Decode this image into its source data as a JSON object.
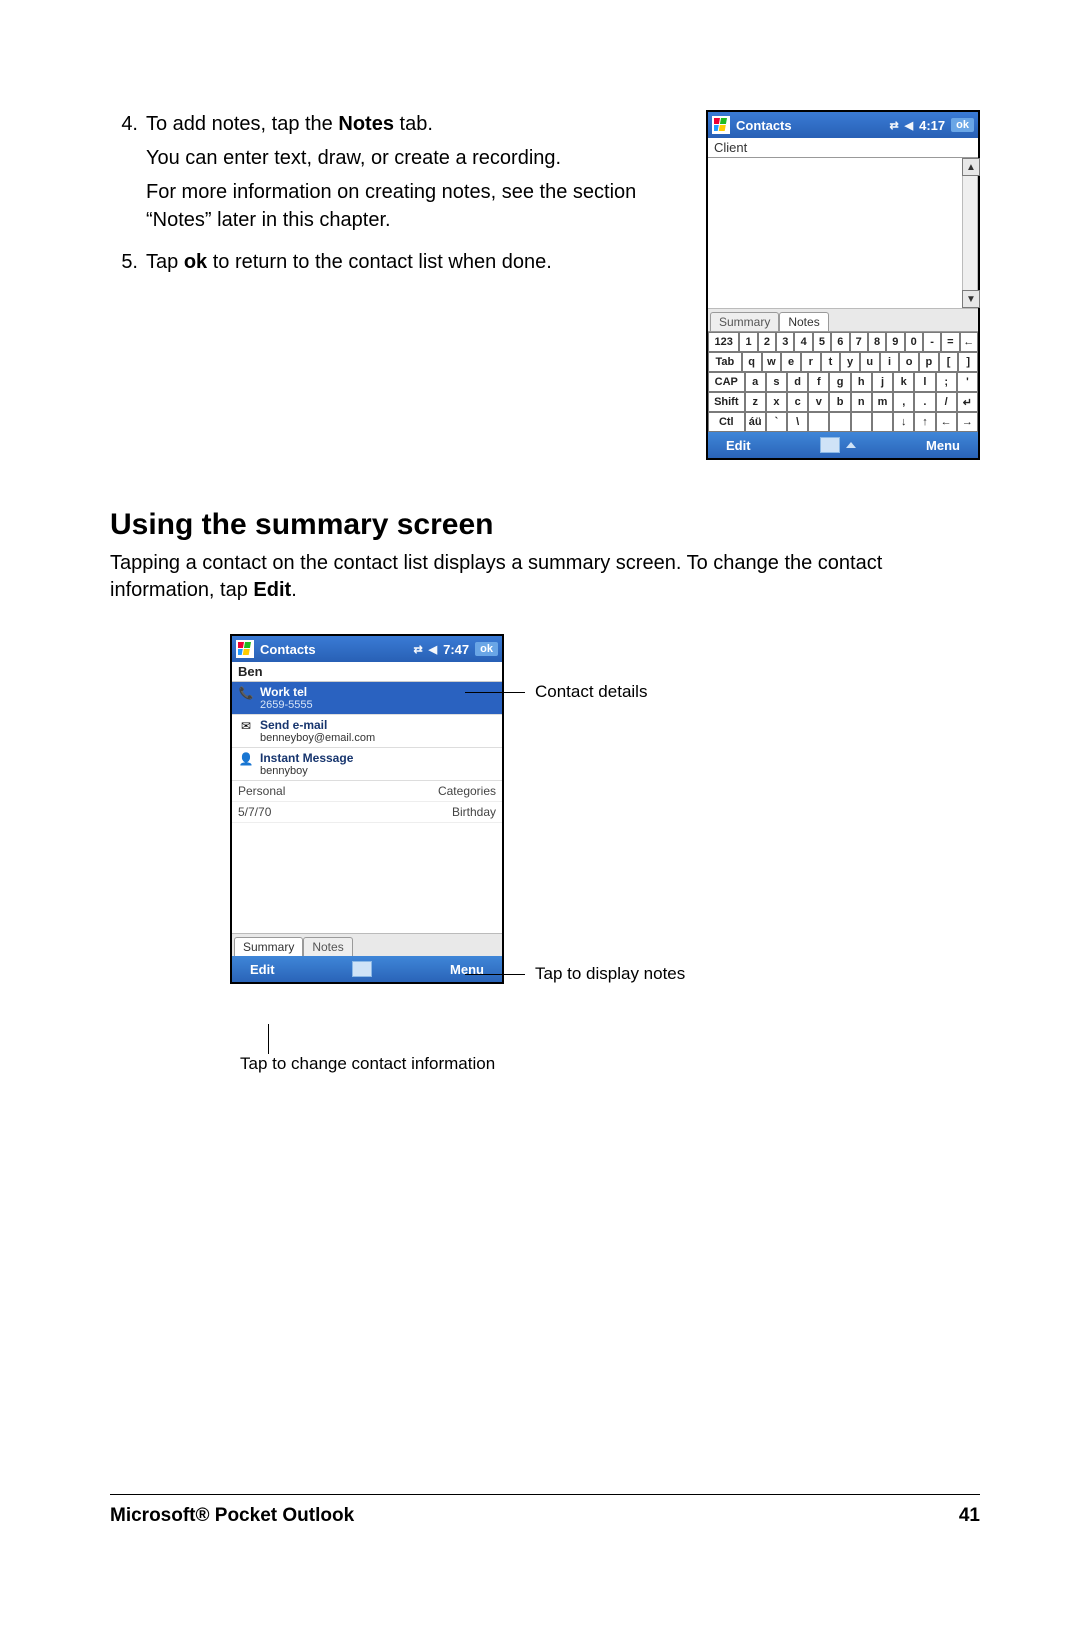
{
  "steps": {
    "item4": {
      "num": "4.",
      "line1_a": "To add notes, tap the ",
      "line1_b": "Notes",
      "line1_c": " tab.",
      "line2": "You can enter text, draw, or create a recording.",
      "line3": "For more information on creating notes, see the section  “Notes” later in this chapter."
    },
    "item5": {
      "num": "5.",
      "line1_a": "Tap ",
      "line1_b": "ok",
      "line1_c": " to return to the contact list when done."
    }
  },
  "device1": {
    "title": "Contacts",
    "time": "4:17",
    "ok": "ok",
    "note_text": "Client",
    "tab_summary": "Summary",
    "tab_notes": "Notes",
    "soft_left": "Edit",
    "soft_right": "Menu",
    "kb": {
      "r1": [
        "123",
        "1",
        "2",
        "3",
        "4",
        "5",
        "6",
        "7",
        "8",
        "9",
        "0",
        "-",
        "=",
        "←"
      ],
      "r2": [
        "Tab",
        "q",
        "w",
        "e",
        "r",
        "t",
        "y",
        "u",
        "i",
        "o",
        "p",
        "[",
        "]"
      ],
      "r3": [
        "CAP",
        "a",
        "s",
        "d",
        "f",
        "g",
        "h",
        "j",
        "k",
        "l",
        ";",
        "'"
      ],
      "r4": [
        "Shift",
        "z",
        "x",
        "c",
        "v",
        "b",
        "n",
        "m",
        ",",
        ".",
        "/",
        "↵"
      ],
      "r5": [
        "Ctl",
        "áü",
        "`",
        "\\",
        "",
        "",
        "",
        "",
        "↓",
        "↑",
        "←",
        "→"
      ]
    }
  },
  "section": {
    "heading": "Using the summary screen",
    "body_a": "Tapping a contact on the contact list displays a summary screen. To change the contact information, tap ",
    "body_b": "Edit",
    "body_c": "."
  },
  "device2": {
    "title": "Contacts",
    "time": "7:47",
    "ok": "ok",
    "contact_name": "Ben",
    "items": [
      {
        "label": "Work tel",
        "value": "2659-5555",
        "icon": "phone"
      },
      {
        "label": "Send e-mail",
        "value": "benneyboy@email.com",
        "icon": "mail"
      },
      {
        "label": "Instant Message",
        "value": "bennyboy",
        "icon": "im"
      }
    ],
    "meta1_left": "Personal",
    "meta1_right": "Categories",
    "meta2_left": "5/7/70",
    "meta2_right": "Birthday",
    "tab_summary": "Summary",
    "tab_notes": "Notes",
    "soft_left": "Edit",
    "soft_right": "Menu"
  },
  "callouts": {
    "details": "Contact details",
    "notes": "Tap to display notes",
    "edit": "Tap to change contact information"
  },
  "footer": {
    "left": "Microsoft® Pocket Outlook",
    "right": "41"
  }
}
